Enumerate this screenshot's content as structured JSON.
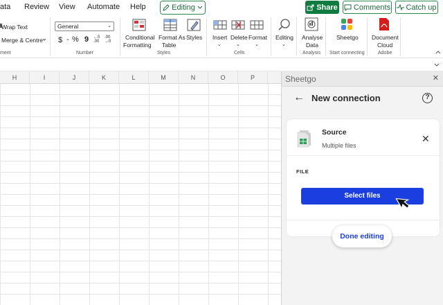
{
  "ribbon_tabs": [
    "ata",
    "Review",
    "View",
    "Automate",
    "Help"
  ],
  "editing_mode": "Editing",
  "share_label": "Share",
  "comments_label": "Comments",
  "catchup_label": "Catch up",
  "alignment": {
    "wrap_text": "Wrap Text",
    "merge_centre": "Merge & Centre",
    "group_label": "ment"
  },
  "number": {
    "format_value": "General",
    "currency": "$",
    "percent": "%",
    "comma": "9",
    "increase_decimal": "←0 .00",
    "decrease_decimal": ".00 →0",
    "group_label": "Number"
  },
  "styles": {
    "conditional_formatting": "Conditional",
    "conditional_formatting_2": "Formatting",
    "format_as_table": "Format As",
    "format_as_table_2": "Table",
    "styles": "Styles",
    "group_label": "Styles"
  },
  "cells": {
    "insert": "Insert",
    "delete": "Delete",
    "format": "Format",
    "group_label": "Cells"
  },
  "editing_group": {
    "editing": "Editing"
  },
  "analysis": {
    "analyse_data": "Analyse",
    "analyse_data_2": "Data",
    "group_label": "Analysis"
  },
  "start_connecting": {
    "sheetgo": "Sheetgo",
    "group_label": "Start connecting"
  },
  "adobe": {
    "document_cloud": "Document",
    "document_cloud_2": "Cloud",
    "group_label": "Adobe"
  },
  "columns": [
    "H",
    "I",
    "J",
    "K",
    "L",
    "M",
    "N",
    "O",
    "P"
  ],
  "panel": {
    "app_title": "Sheetgo",
    "heading": "New connection",
    "help": "?",
    "source_title": "Source",
    "source_subtitle": "Multiple files",
    "file_section_label": "FILE",
    "select_files_label": "Select files",
    "done_editing_label": "Done editing"
  },
  "colors": {
    "excel_green": "#0f7b3f",
    "sheetgo_blue": "#1a3ee0"
  }
}
